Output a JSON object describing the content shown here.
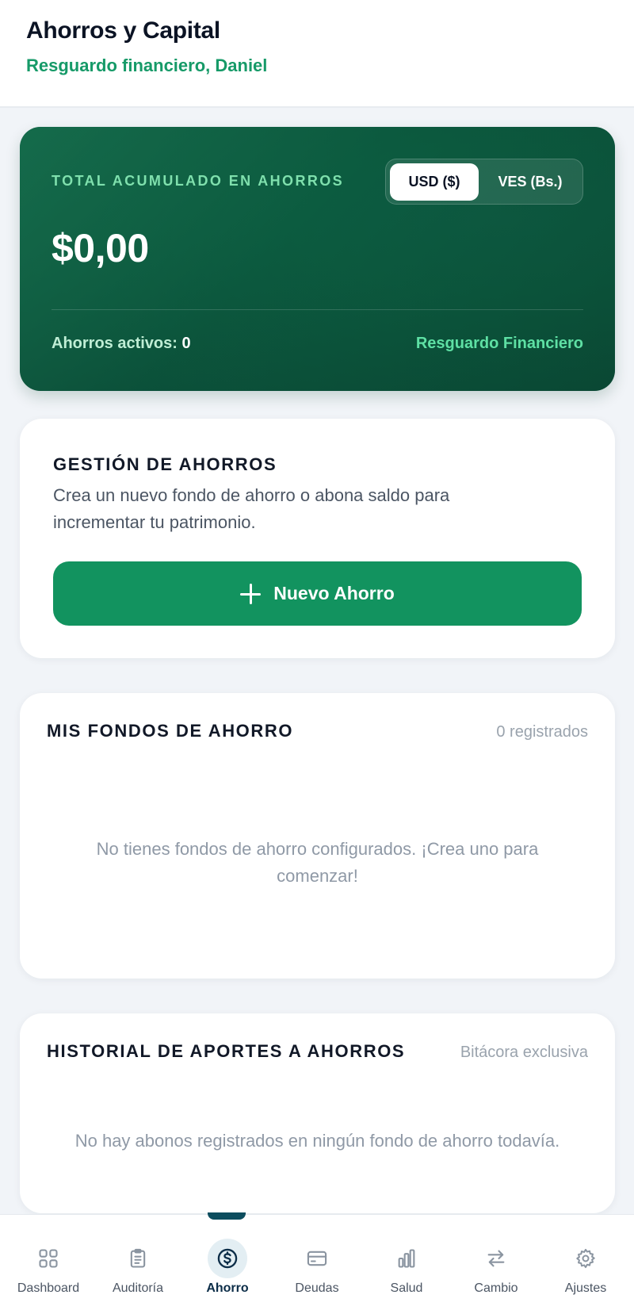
{
  "header": {
    "title": "Ahorros y Capital",
    "subtitle": "Resguardo financiero, Daniel"
  },
  "summary": {
    "label": "TOTAL ACUMULADO EN AHORROS",
    "currency_options": [
      "USD ($)",
      "VES (Bs.)"
    ],
    "selected_currency": "USD ($)",
    "amount": "$0,00",
    "active_label": "Ahorros activos:",
    "active_count": "0",
    "footer_right": "Resguardo Financiero"
  },
  "manage": {
    "title": "GESTIÓN DE AHORROS",
    "description": "Crea un nuevo fondo de ahorro o abona saldo para incrementar tu patrimonio.",
    "button_label": "Nuevo Ahorro",
    "button_icon": "plus-icon"
  },
  "funds": {
    "title": "MIS FONDOS DE AHORRO",
    "meta": "0 registrados",
    "empty": "No tienes fondos de ahorro configurados. ¡Crea uno para comenzar!"
  },
  "history": {
    "title": "HISTORIAL DE APORTES A AHORROS",
    "meta": "Bitácora exclusiva",
    "empty": "No hay abonos registrados en ningún fondo de ahorro todavía."
  },
  "nav": {
    "items": [
      {
        "label": "Dashboard",
        "icon": "grid-icon"
      },
      {
        "label": "Auditoría",
        "icon": "clipboard-icon"
      },
      {
        "label": "Ahorro",
        "icon": "dollar-circle-icon",
        "active": true
      },
      {
        "label": "Deudas",
        "icon": "credit-card-icon"
      },
      {
        "label": "Salud",
        "icon": "bar-chart-icon"
      },
      {
        "label": "Cambio",
        "icon": "swap-arrows-icon"
      },
      {
        "label": "Ajustes",
        "icon": "gear-icon"
      }
    ]
  },
  "colors": {
    "accent": "#12935f",
    "accent_text": "#169a68",
    "card_dark": "#0b5a40",
    "nav_active": "#0c4d5e"
  }
}
